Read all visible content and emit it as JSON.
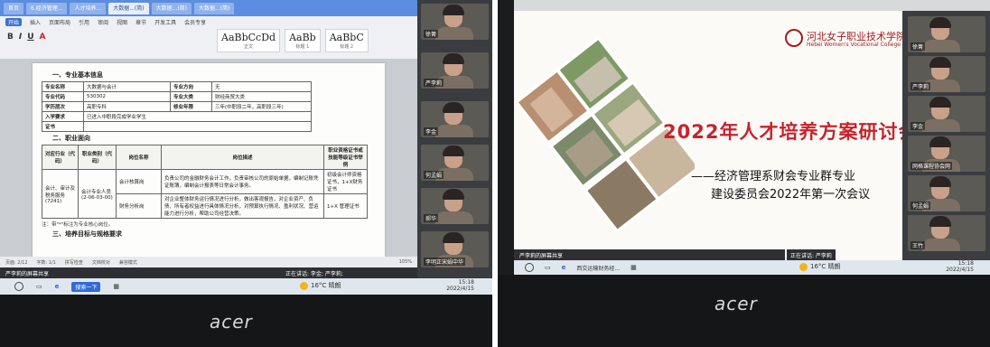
{
  "left": {
    "tabs": [
      "首页",
      "6.经济管理...",
      "人才培养...",
      "大数据...(简)",
      "大数据...(简)",
      "大数据...(简)"
    ],
    "menu": [
      "开始",
      "插入",
      "页面布局",
      "引用",
      "审阅",
      "视图",
      "章节",
      "开发工具",
      "会员专享"
    ],
    "style_previews": [
      {
        "sample": "AaBbCcDd",
        "label": "正文"
      },
      {
        "sample": "AaBb",
        "label": "标题 1"
      },
      {
        "sample": "AaBbC",
        "label": "标题 2"
      }
    ],
    "doc": {
      "section_title": "一、专业基本信息",
      "info_rows": [
        [
          "专业名称",
          "大数据与会计",
          "专业方向",
          "无"
        ],
        [
          "专业代码",
          "530302",
          "专业大类",
          "财经商贸大类"
        ],
        [
          "学历层次",
          "高职专科",
          "修业年限",
          "三年(中职段二年，高职段三年)"
        ],
        [
          "入学要求",
          "已进入中职段完成学业学生",
          "",
          ""
        ],
        [
          "证书",
          "",
          "",
          ""
        ]
      ],
      "section2_title": "二、职业面向",
      "job_headers": [
        "对应行业（代码）",
        "职业类别（代码）",
        "岗位名称",
        "岗位描述",
        "职业资格证书或技能等级证书举例"
      ],
      "job_rows": [
        [
          "会计、审计及税务服务(7241)",
          "会计专业人员(2-06-03-00)",
          "会计核算岗",
          "负责公司的金融财务会计工作，负责审核公司的原始单据，编制记账凭证账簿，编制会计报表等日常会计事务。",
          "初级会计师资格证书，1+X财务证书"
        ],
        [
          "",
          "",
          "财务分析岗",
          "对企业整体财务运行情况进行分析，做出客观报告，对企业资产、负债、所有者权益进行具体情况分析，对预算执行情况、盈利状况、营运能力进行分析，帮助公司经营决策。",
          "1+X 管理证书"
        ]
      ],
      "note": "注：带\"*\"标注为专业核心岗位。",
      "section3_title": "三、培养目标与规格要求"
    },
    "status_text": "页面: 2/12　　字数: 1/1　　拼写检查　　文档校对　　兼容模式",
    "zoom": "105%",
    "share_label": "严李莉的屏幕共享",
    "speaking": "正在讲话: 李金; 严李莉;",
    "taskbar_search": "搜索一下",
    "weather": "16°C 晴朗",
    "clock_time": "15:18",
    "clock_date": "2022/4/15",
    "participants": [
      "徐菁",
      "严李莉",
      "李金",
      "何孟娟",
      "郝华",
      "李明正宋娟中华"
    ]
  },
  "right": {
    "school_name_cn": "河北女子职业技术学院",
    "school_name_en": "Hebei Women's Vocational College",
    "title": "2022年人才培养方案研讨会",
    "subtitle1": "——经济管理系财会专业群专业",
    "subtitle2": "建设委员会2022年第一次会议",
    "share_label": "严李莉的屏幕共享",
    "speaking": "正在讲话: 严李莉",
    "taskbar_search": "西交运输财务经...",
    "weather": "16°C 晴朗",
    "clock_time": "15:18",
    "clock_date": "2022/4/15",
    "participants": [
      "徐菁",
      "严李莉",
      "李金",
      "网格课程协会网",
      "何孟娟",
      "王竹"
    ]
  },
  "brand": "acer",
  "colors": {
    "title_red": "#c8232c",
    "taskbar": "#dfe6ee",
    "wps_blue": "#5b8de0"
  }
}
